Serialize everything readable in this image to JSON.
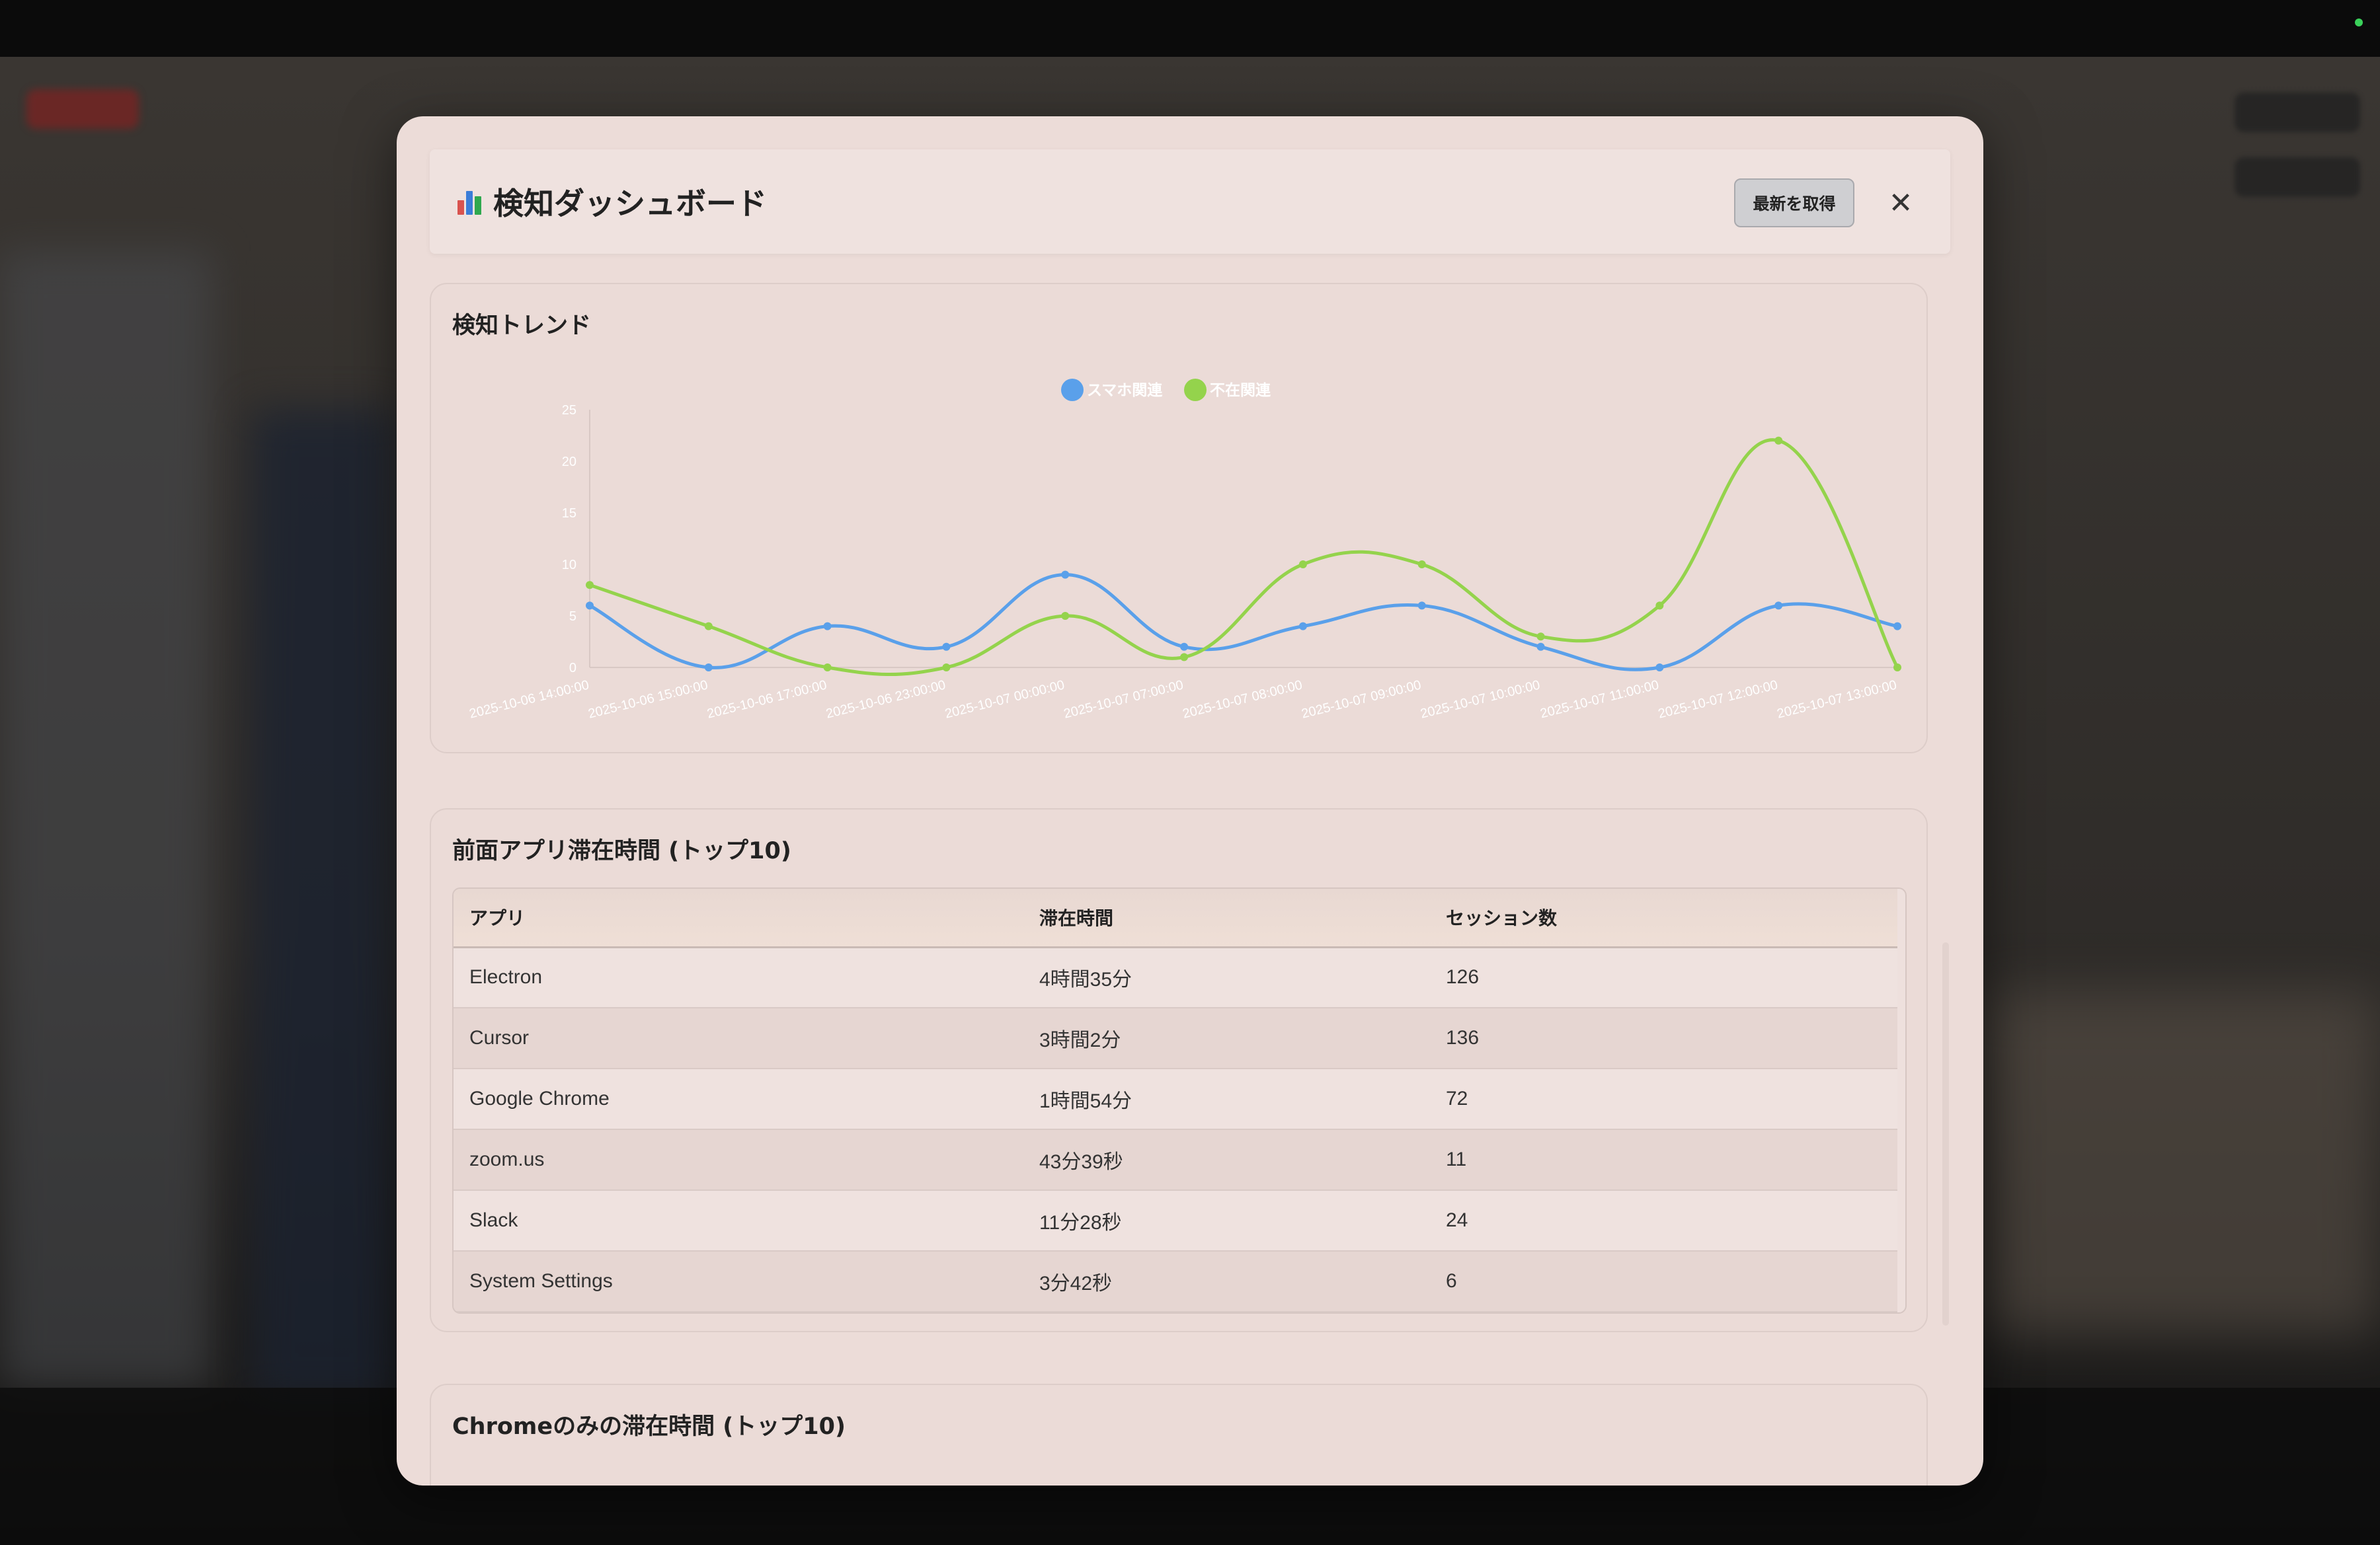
{
  "modal": {
    "title": "検知ダッシュボード",
    "refresh_label": "最新を取得",
    "close_symbol": "✕"
  },
  "trend": {
    "title": "検知トレンド"
  },
  "chart_data": {
    "type": "line",
    "categories": [
      "2025-10-06 14:00:00",
      "2025-10-06 15:00:00",
      "2025-10-06 17:00:00",
      "2025-10-06 23:00:00",
      "2025-10-07 00:00:00",
      "2025-10-07 07:00:00",
      "2025-10-07 08:00:00",
      "2025-10-07 09:00:00",
      "2025-10-07 10:00:00",
      "2025-10-07 11:00:00",
      "2025-10-07 12:00:00",
      "2025-10-07 13:00:00"
    ],
    "series": [
      {
        "name": "スマホ関連",
        "color": "#5aa0ea",
        "values": [
          6,
          0,
          4,
          2,
          9,
          2,
          4,
          6,
          2,
          0,
          6,
          4
        ]
      },
      {
        "name": "不在関連",
        "color": "#94d34c",
        "values": [
          8,
          4,
          0,
          0,
          5,
          1,
          10,
          10,
          3,
          6,
          22,
          0
        ]
      }
    ],
    "yticks": [
      "0",
      "5",
      "10",
      "15",
      "20",
      "25"
    ],
    "ylim": [
      0,
      25
    ],
    "legend": "top-center",
    "smooth": true
  },
  "apps": {
    "title": "前面アプリ滞在時間 (トップ10)",
    "columns": [
      "アプリ",
      "滞在時間",
      "セッション数"
    ],
    "rows": [
      [
        "Electron",
        "4時間35分",
        "126"
      ],
      [
        "Cursor",
        "3時間2分",
        "136"
      ],
      [
        "Google Chrome",
        "1時間54分",
        "72"
      ],
      [
        "zoom.us",
        "43分39秒",
        "11"
      ],
      [
        "Slack",
        "11分28秒",
        "24"
      ],
      [
        "System Settings",
        "3分42秒",
        "6"
      ]
    ]
  },
  "chrome": {
    "title": "Chromeのみの滞在時間 (トップ10)"
  }
}
